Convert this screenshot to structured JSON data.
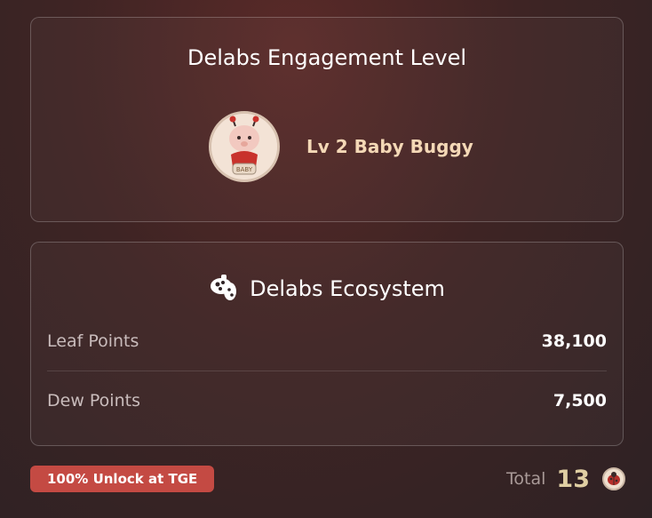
{
  "engagement": {
    "title": "Delabs Engagement Level",
    "level_label": "Lv 2 Baby Buggy",
    "avatar_icon": "baby-buggy-avatar-icon"
  },
  "ecosystem": {
    "title": "Delabs Ecosystem",
    "icon": "delabs-logo-icon",
    "rows": [
      {
        "label": "Leaf Points",
        "value": "38,100"
      },
      {
        "label": "Dew Points",
        "value": "7,500"
      }
    ]
  },
  "footer": {
    "badge": "100% Unlock at TGE",
    "total_label": "Total",
    "total_value": "13",
    "coin_icon": "ladybug-coin-icon"
  },
  "colors": {
    "badge_bg": "#c44a43",
    "level_text": "#f4d8b6",
    "total_value": "#e0cfa3"
  }
}
